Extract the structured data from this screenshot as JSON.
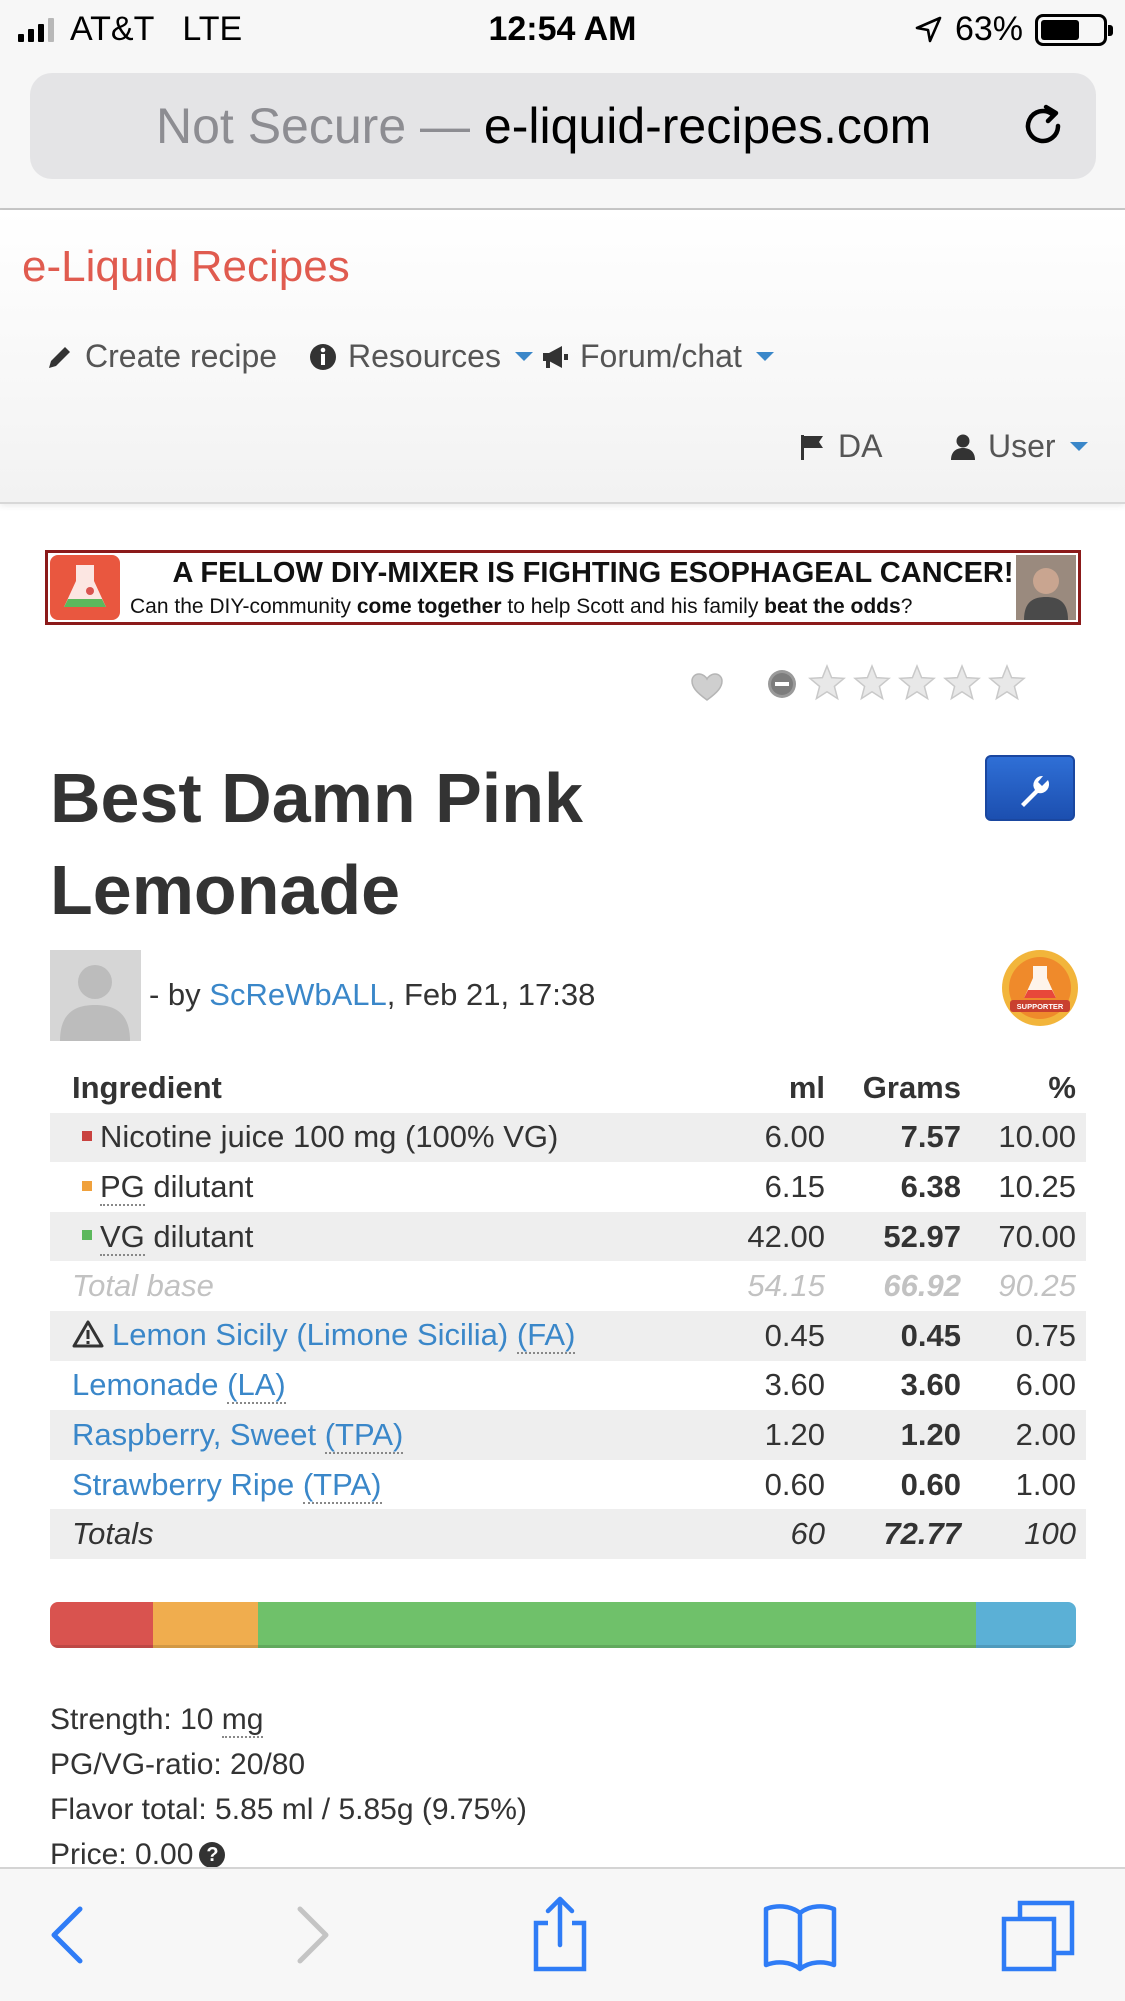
{
  "status_bar": {
    "carrier": "AT&T",
    "network": "LTE",
    "time": "12:54 AM",
    "battery": "63%",
    "battery_level": 0.63
  },
  "browser": {
    "security": "Not Secure —",
    "domain": "e-liquid-recipes.com"
  },
  "nav": {
    "brand": "e-Liquid Recipes",
    "create_recipe": "Create recipe",
    "resources": "Resources",
    "forum": "Forum/chat",
    "language": "DA",
    "user": "User"
  },
  "banner": {
    "headline": "A FELLOW DIY-MIXER IS FIGHTING ESOPHAGEAL CANCER!",
    "sub_a": "Can the DIY-community ",
    "sub_b": "come together",
    "sub_c": " to help Scott and his family ",
    "sub_d": "beat the odds",
    "sub_e": "?"
  },
  "rating": {
    "stars_filled": 0,
    "stars_total": 5
  },
  "recipe": {
    "title": "Best Damn Pink Lemonade",
    "by_prefix": "- by ",
    "author": "ScReWbALL",
    "date_suffix": ", Feb 21, 17:38",
    "badge": "SUPPORTER"
  },
  "table": {
    "headers": {
      "ingredient": "Ingredient",
      "ml": "ml",
      "grams": "Grams",
      "pct": "%"
    },
    "base_rows": [
      {
        "pre": "Nicotine juice 100 mg (100% VG)",
        "abbr": "",
        "post": "",
        "ml": "6.00",
        "g": "7.57",
        "pct": "10.00",
        "color": "#c9423f"
      },
      {
        "pre": "",
        "abbr": "PG",
        "post": " dilutant",
        "ml": "6.15",
        "g": "6.38",
        "pct": "10.25",
        "color": "#f0a13c"
      },
      {
        "pre": "",
        "abbr": "VG",
        "post": " dilutant",
        "ml": "42.00",
        "g": "52.97",
        "pct": "70.00",
        "color": "#5cb85c"
      }
    ],
    "total_base": {
      "label": "Total base",
      "ml": "54.15",
      "g": "66.92",
      "pct": "90.25"
    },
    "flavor_rows": [
      {
        "name": "Lemon Sicily (Limone Sicilia) ",
        "abbr": "(FA)",
        "ml": "0.45",
        "g": "0.45",
        "pct": "0.75",
        "warn": true
      },
      {
        "name": "Lemonade ",
        "abbr": "(LA)",
        "ml": "3.60",
        "g": "3.60",
        "pct": "6.00",
        "warn": false
      },
      {
        "name": "Raspberry, Sweet ",
        "abbr": "(TPA)",
        "ml": "1.20",
        "g": "1.20",
        "pct": "2.00",
        "warn": false
      },
      {
        "name": "Strawberry Ripe ",
        "abbr": "(TPA)",
        "ml": "0.60",
        "g": "0.60",
        "pct": "1.00",
        "warn": false
      }
    ],
    "totals": {
      "label": "Totals",
      "ml": "60",
      "g": "72.77",
      "pct": "100"
    }
  },
  "composition_bar": [
    {
      "name": "Nicotine juice",
      "pct": 10.0,
      "color": "#d9534f"
    },
    {
      "name": "PG dilutant",
      "pct": 10.25,
      "color": "#f0ad4e"
    },
    {
      "name": "VG dilutant",
      "pct": 70.0,
      "color": "#6fc16a"
    },
    {
      "name": "Flavors",
      "pct": 9.75,
      "color": "#5bb0d6"
    }
  ],
  "stats": {
    "strength_label": "Strength: 10 ",
    "strength_unit": "mg",
    "ratio": "PG/VG-ratio: 20/80",
    "flavor_total": "Flavor total: 5.85 ml / 5.85g (9.75%)",
    "price": "Price: 0.00",
    "price_help": "?"
  }
}
